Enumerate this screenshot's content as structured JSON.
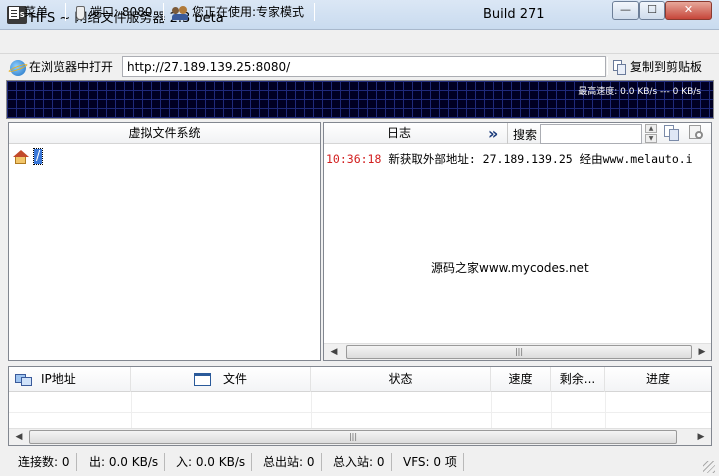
{
  "window": {
    "app_icon_text": "HFS",
    "title": "HFS ~ 网络文件服务器 2.3 beta",
    "build": "Build 271",
    "min_glyph": "—",
    "max_glyph": "☐",
    "close_glyph": "✕"
  },
  "toolbar": {
    "menu_label": "菜单",
    "port_label": "端口: 8080",
    "mode_label": "您正在使用:专家模式"
  },
  "address": {
    "open_browser_label": "在浏览器中打开",
    "url": "http://27.189.139.25:8080/",
    "copy_label": "复制到剪贴板"
  },
  "graph": {
    "speed_label": "最高速度: 0.0 KB/s --- 0 KB/s"
  },
  "vfs": {
    "header": "虚拟文件系统",
    "root_item": "/"
  },
  "log": {
    "header": "日志",
    "expand_glyph": "»",
    "search_label": "搜索",
    "search_value": "",
    "entries": [
      {
        "time": "10:36:18",
        "message": "新获取外部地址: 27.189.139.25 经由www.melauto.i"
      }
    ],
    "watermark": "源码之家www.mycodes.net"
  },
  "connections": {
    "columns": [
      "IP地址",
      "文件",
      "状态",
      "速度",
      "剩余...",
      "进度"
    ]
  },
  "status": {
    "connections": "连接数: 0",
    "out": "出: 0.0 KB/s",
    "in": "入: 0.0 KB/s",
    "total_out": "总出站: 0",
    "total_in": "总入站: 0",
    "vfs": "VFS: 0 项"
  },
  "scroll": {
    "left_arrow": "◀",
    "right_arrow": "▶",
    "up_arrow": "▲",
    "down_arrow": "▼",
    "thumb_grip": "|||"
  },
  "colors": {
    "log_time": "#d22020",
    "graph_bg": "#000022",
    "graph_grid": "#1f2a7a"
  }
}
